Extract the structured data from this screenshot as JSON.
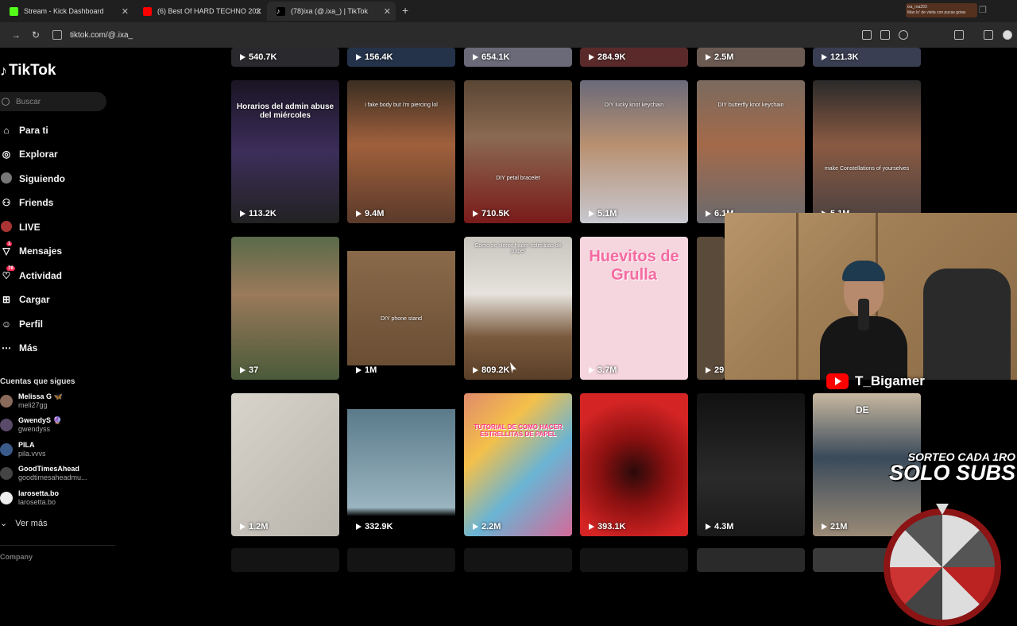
{
  "browser": {
    "tabs": [
      {
        "title": "Stream - Kick Dashboard",
        "color": "#53fc18"
      },
      {
        "title": "(6) Best Of HARD TECHNO 202",
        "color": "#ff0000"
      },
      {
        "title": "(78)ixa (@.ixa_) | TikTok",
        "color": "#ffffff"
      }
    ],
    "url": "tiktok.com/@.ixa_",
    "overlay_line1": "ixa_roa293",
    "overlay_line2": "Man lo' de visita con pucas gotas"
  },
  "sidebar": {
    "logo": "TikTok",
    "search_placeholder": "Buscar",
    "nav": [
      {
        "label": "Para ti",
        "icon": "home-icon"
      },
      {
        "label": "Explorar",
        "icon": "compass-icon"
      },
      {
        "label": "Siguiendo",
        "icon": "following-icon"
      },
      {
        "label": "Friends",
        "icon": "friends-icon"
      },
      {
        "label": "LIVE",
        "icon": "live-icon"
      },
      {
        "label": "Mensajes",
        "icon": "messages-icon",
        "badge": "1"
      },
      {
        "label": "Actividad",
        "icon": "activity-icon",
        "badge": "78"
      },
      {
        "label": "Cargar",
        "icon": "upload-icon"
      },
      {
        "label": "Perfil",
        "icon": "profile-icon"
      },
      {
        "label": "Más",
        "icon": "more-icon"
      }
    ],
    "following_title": "Cuentas que sigues",
    "following": [
      {
        "name": "Melissa G 🦋",
        "user": "meli27gg"
      },
      {
        "name": "GwendyS 🔮",
        "user": "gwendyss"
      },
      {
        "name": "PILA",
        "user": "pila.vvvs"
      },
      {
        "name": "GoodTimesAhead",
        "user": "goodtimesaheadmu..."
      },
      {
        "name": "larosetta.bo",
        "user": "larosetta.bo"
      }
    ],
    "ver_mas": "Ver más",
    "company": "Company"
  },
  "grid": {
    "row0": [
      "540.7K",
      "156.4K",
      "654.1K",
      "284.9K",
      "2.5M",
      "121.3K"
    ],
    "row1": [
      {
        "views": "113.2K",
        "caption": "Horarios del admin abuse del miércoles"
      },
      {
        "views": "9.4M",
        "caption": "i fake body but i'm piercing lol"
      },
      {
        "views": "710.5K",
        "caption": "DIY petal bracelet"
      },
      {
        "views": "5.1M",
        "caption": "DIY lucky knot keychain"
      },
      {
        "views": "6.1M",
        "caption": "DIY butterfly knot keychain"
      },
      {
        "views": "5.1M",
        "caption": "make Constellations of yourselves"
      }
    ],
    "row2": [
      {
        "views": "37",
        "caption": ""
      },
      {
        "views": "1M",
        "caption": "DIY phone stand"
      },
      {
        "views": "809.2K",
        "caption": "Como se siente hacer estrellitas de papel"
      },
      {
        "views": "3.7M",
        "caption": "Huevitos de Grulla"
      },
      {
        "views": "29",
        "caption": ""
      }
    ],
    "row3": [
      {
        "views": "1.2M",
        "caption": ""
      },
      {
        "views": "332.9K",
        "caption": ""
      },
      {
        "views": "2.2M",
        "caption": "TUTORIAL DE COMO HACER ESTRELLITAS DE PAPEL"
      },
      {
        "views": "393.1K",
        "caption": ""
      },
      {
        "views": "4.3M",
        "caption": ""
      },
      {
        "views": "21M",
        "caption": "DE"
      }
    ]
  },
  "stream": {
    "channel": "T_Bigamer",
    "promo_line1": "SORTEO CADA 1RO",
    "promo_line2": "SOLO SUBS"
  }
}
